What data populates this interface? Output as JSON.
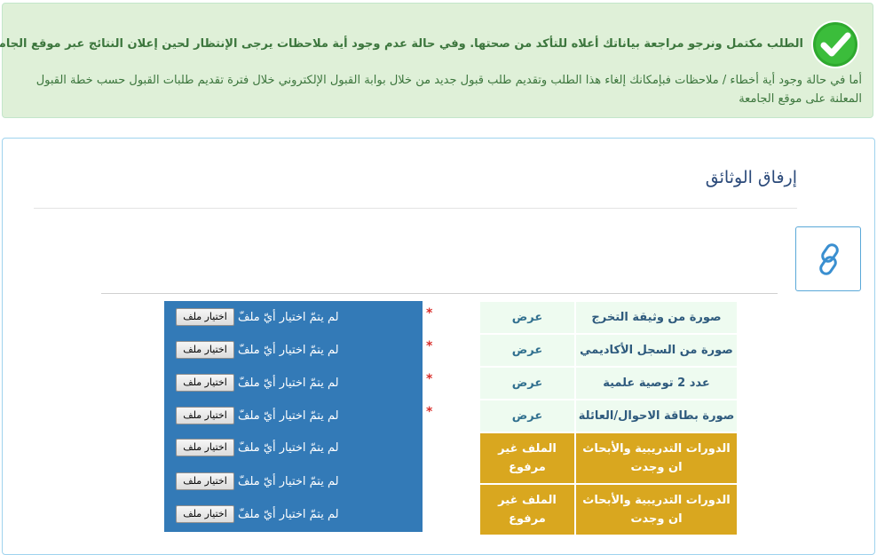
{
  "alert": {
    "message_bold": "الطلب مكتمل ونرجو مراجعة بياناتك أعلاه للتأكد من صحتها. وفي حالة عدم وجود أية ملاحظات يرجى الإنتظار لحين إعلان النتائج عبر موقع الجامعة.",
    "message_detail": "أما في حالة وجود أية أخطاء / ملاحظات فبإمكانك إلغاء هذا الطلب وتقديم طلب قبول جديد من خلال بوابة القبول الإلكتروني خلال فترة تقديم طلبات القبول حسب خطة القبول المعلنة على موقع الجامعة",
    "icon": "check-circle-icon",
    "color": "#3c763d"
  },
  "section": {
    "title": "إرفاق الوثائق",
    "link_icon": "link-icon"
  },
  "documents": [
    {
      "name": "صورة من وثيقة التخرج",
      "status": "عرض",
      "state": "uploaded",
      "required": true
    },
    {
      "name": "صورة من السجل الأكاديمي",
      "status": "عرض",
      "state": "uploaded",
      "required": true
    },
    {
      "name": "عدد 2 توصية علمية",
      "status": "عرض",
      "state": "uploaded",
      "required": true
    },
    {
      "name": "صورة بطاقة الاحوال/العائلة",
      "status": "عرض",
      "state": "uploaded",
      "required": true
    },
    {
      "name": "الدورات التدريبية والأبحاث ان وجدت",
      "status": "الملف غير مرفوع",
      "state": "missing",
      "required": false
    },
    {
      "name": "الدورات التدريبية والأبحاث ان وجدت",
      "status": "الملف غير مرفوع",
      "state": "missing",
      "required": false
    }
  ],
  "uploads": [
    {
      "button": "اختيار ملف",
      "status": "لم يتمّ اختيار أيّ ملفّ"
    },
    {
      "button": "اختيار ملف",
      "status": "لم يتمّ اختيار أيّ ملفّ"
    },
    {
      "button": "اختيار ملف",
      "status": "لم يتمّ اختيار أيّ ملفّ"
    },
    {
      "button": "اختيار ملف",
      "status": "لم يتمّ اختيار أيّ ملفّ"
    },
    {
      "button": "اختيار ملف",
      "status": "لم يتمّ اختيار أيّ ملفّ"
    },
    {
      "button": "اختيار ملف",
      "status": "لم يتمّ اختيار أيّ ملفّ"
    },
    {
      "button": "اختيار ملف",
      "status": "لم يتمّ اختيار أيّ ملفّ"
    }
  ],
  "required_mark": "*",
  "colors": {
    "uploaded_bg": "#eefbf0",
    "missing_bg": "#d9a71f",
    "upload_panel": "#337ab7",
    "required": "#d9302c"
  }
}
